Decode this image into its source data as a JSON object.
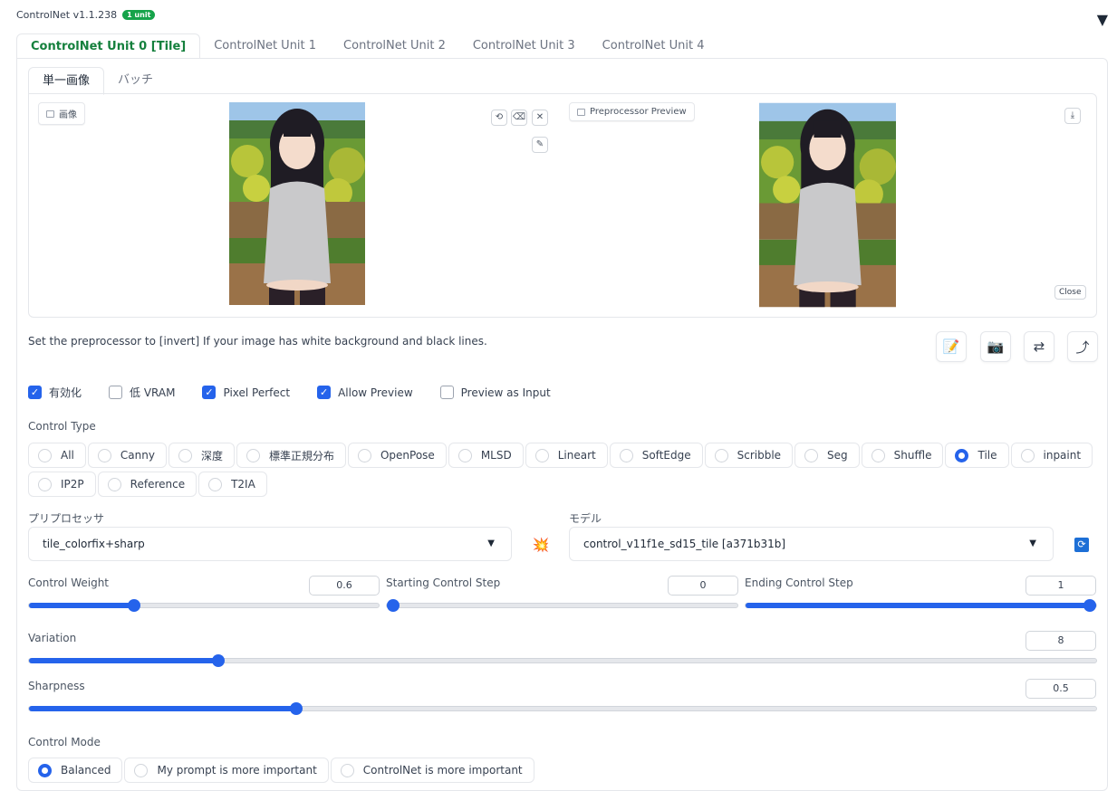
{
  "header": {
    "title": "ControlNet v1.1.238",
    "badge": "1 unit",
    "collapse_icon": "▼"
  },
  "unit_tabs": [
    "ControlNet Unit 0 [Tile]",
    "ControlNet Unit 1",
    "ControlNet Unit 2",
    "ControlNet Unit 3",
    "ControlNet Unit 4"
  ],
  "image_tabs": [
    "単一画像",
    "バッチ"
  ],
  "image_panel": {
    "image_label": "画像",
    "preview_label": "Preprocessor Preview",
    "close_label": "Close"
  },
  "hint": "Set the preprocessor to [invert] If your image has white background and black lines.",
  "checkboxes": [
    {
      "label": "有効化",
      "checked": true
    },
    {
      "label": "低 VRAM",
      "checked": false
    },
    {
      "label": "Pixel Perfect",
      "checked": true
    },
    {
      "label": "Allow Preview",
      "checked": true
    },
    {
      "label": "Preview as Input",
      "checked": false
    }
  ],
  "control_type": {
    "label": "Control Type",
    "row1": [
      "All",
      "Canny",
      "深度",
      "標準正規分布",
      "OpenPose",
      "MLSD",
      "Lineart",
      "SoftEdge",
      "Scribble",
      "Seg",
      "Shuffle",
      "Tile",
      "inpaint"
    ],
    "row2": [
      "IP2P",
      "Reference",
      "T2IA"
    ],
    "selected": "Tile"
  },
  "preprocessor": {
    "label": "プリプロセッサ",
    "value": "tile_colorfix+sharp"
  },
  "model": {
    "label": "モデル",
    "value": "control_v11f1e_sd15_tile [a371b31b]"
  },
  "sliders": {
    "control_weight": {
      "label": "Control Weight",
      "value": "0.6",
      "fraction": 0.3
    },
    "starting_step": {
      "label": "Starting Control Step",
      "value": "0",
      "fraction": 0.0
    },
    "ending_step": {
      "label": "Ending Control Step",
      "value": "1",
      "fraction": 1.0
    },
    "variation": {
      "label": "Variation",
      "value": "8",
      "fraction": 0.177
    },
    "sharpness": {
      "label": "Sharpness",
      "value": "0.5",
      "fraction": 0.25
    }
  },
  "control_mode": {
    "label": "Control Mode",
    "options": [
      "Balanced",
      "My prompt is more important",
      "ControlNet is more important"
    ],
    "selected": "Balanced"
  },
  "colors": {
    "accent": "#2563eb",
    "active_tab": "#15803d",
    "badge": "#16a34a"
  }
}
